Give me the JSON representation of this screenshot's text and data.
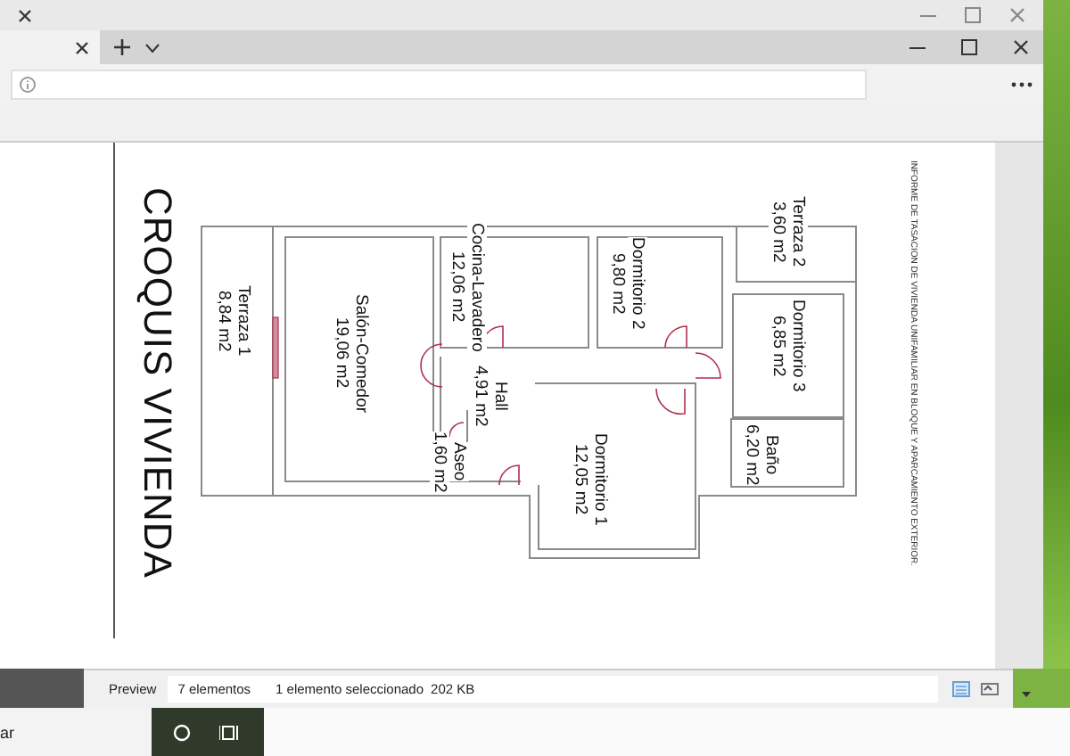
{
  "document": {
    "title": "CROQUIS VIVIENDA",
    "header": "INFORME DE TASACION DE VIVIENDA UNIFAMILIAR EN BLOQUE Y APARCAMIENTO EXTERIOR.",
    "rooms": [
      {
        "name": "Terraza 1",
        "area": "8,84 m2"
      },
      {
        "name": "Salón-Comedor",
        "area": "19,06 m2"
      },
      {
        "name": "Cocina-Lavadero",
        "area": "12,06 m2"
      },
      {
        "name": "Hall",
        "area": "4,91 m2"
      },
      {
        "name": "Aseo",
        "area": "1,60 m2"
      },
      {
        "name": "Dormitorio 1",
        "area": "12,05 m2"
      },
      {
        "name": "Dormitorio 2",
        "area": "9,80 m2"
      },
      {
        "name": "Dormitorio 3",
        "area": "6,85 m2"
      },
      {
        "name": "Baño",
        "area": "6,20 m2"
      },
      {
        "name": "Terraza 2",
        "area": "3,60 m2"
      }
    ]
  },
  "status_bar": {
    "pane": "Preview",
    "items": "7 elementos",
    "selection": "1 elemento seleccionado",
    "size": "202 KB"
  },
  "taskbar": {
    "search": "ar"
  }
}
